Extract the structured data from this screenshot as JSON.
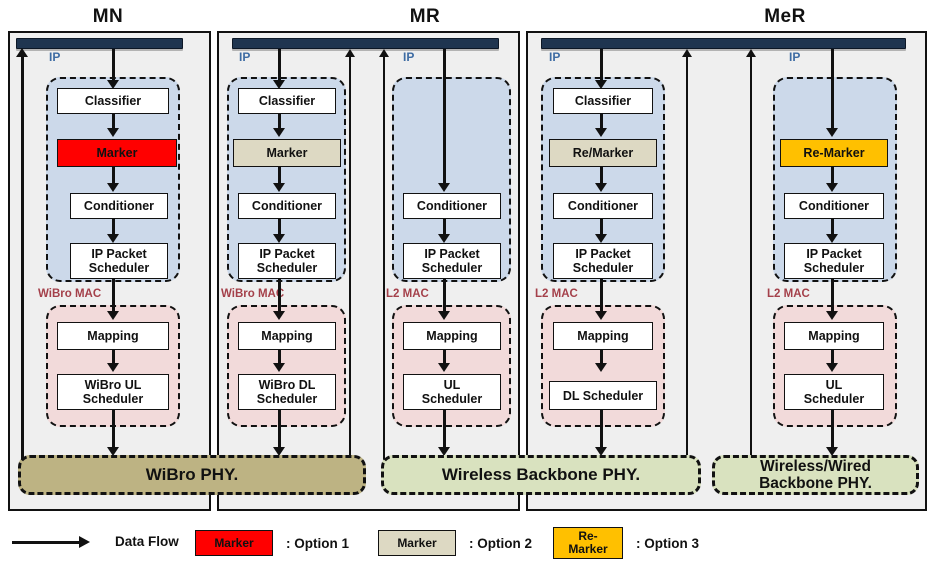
{
  "diagram": {
    "title_row": [
      {
        "label": "MN"
      },
      {
        "label": "MR"
      },
      {
        "label": "MeR"
      }
    ],
    "ip_label": "IP",
    "mac_labels": {
      "wibro": "WiBro MAC",
      "l2": "L2  MAC"
    },
    "columns": [
      {
        "id": "mn",
        "group": "MN",
        "mac_label": "WiBro MAC",
        "ip_blocks": [
          {
            "label": "Classifier",
            "style": "white"
          },
          {
            "label": "Marker",
            "style": "red"
          },
          {
            "label": "Conditioner",
            "style": "white"
          },
          {
            "label": "IP Packet\nScheduler",
            "style": "white"
          }
        ],
        "mac_blocks": [
          {
            "label": "Mapping",
            "style": "white"
          },
          {
            "label": "WiBro UL\nScheduler",
            "style": "white"
          }
        ]
      },
      {
        "id": "mr-access",
        "group": "MR",
        "mac_label": "WiBro MAC",
        "ip_blocks": [
          {
            "label": "Classifier",
            "style": "white"
          },
          {
            "label": "Marker",
            "style": "tan"
          },
          {
            "label": "Conditioner",
            "style": "white"
          },
          {
            "label": "IP Packet\nScheduler",
            "style": "white"
          }
        ],
        "mac_blocks": [
          {
            "label": "Mapping",
            "style": "white"
          },
          {
            "label": "WiBro DL\nScheduler",
            "style": "white"
          }
        ]
      },
      {
        "id": "mr-backbone",
        "group": "MR",
        "mac_label": "L2  MAC",
        "ip_blocks": [
          {
            "label": "Conditioner",
            "style": "white"
          },
          {
            "label": "IP Packet\nScheduler",
            "style": "white"
          }
        ],
        "mac_blocks": [
          {
            "label": "Mapping",
            "style": "white"
          },
          {
            "label": "UL\nScheduler",
            "style": "white"
          }
        ]
      },
      {
        "id": "mer-access",
        "group": "MeR",
        "mac_label": "L2 MAC",
        "ip_blocks": [
          {
            "label": "Classifier",
            "style": "white"
          },
          {
            "label": "Re/Marker",
            "style": "tan"
          },
          {
            "label": "Conditioner",
            "style": "white"
          },
          {
            "label": "IP Packet\nScheduler",
            "style": "white"
          }
        ],
        "mac_blocks": [
          {
            "label": "Mapping",
            "style": "white"
          },
          {
            "label": "DL Scheduler",
            "style": "white"
          }
        ]
      },
      {
        "id": "mer-backbone",
        "group": "MeR",
        "mac_label": "L2  MAC",
        "ip_blocks": [
          {
            "label": "Re-Marker",
            "style": "amber"
          },
          {
            "label": "Conditioner",
            "style": "white"
          },
          {
            "label": "IP Packet\nScheduler",
            "style": "white"
          }
        ],
        "mac_blocks": [
          {
            "label": "Mapping",
            "style": "white"
          },
          {
            "label": "UL\nScheduler",
            "style": "white"
          }
        ]
      }
    ],
    "phy_bars": [
      {
        "label": "WiBro PHY.",
        "style": "wibro"
      },
      {
        "label": "Wireless Backbone PHY.",
        "style": "green"
      },
      {
        "label": "Wireless/Wired\nBackbone PHY.",
        "style": "green"
      }
    ],
    "legend": {
      "data_flow_label": "Data Flow",
      "items": [
        {
          "swatch": "Marker",
          "style": "red",
          "caption": ": Option 1"
        },
        {
          "swatch": "Marker",
          "style": "tan",
          "caption": ": Option 2"
        },
        {
          "swatch": "Re-\nMarker",
          "style": "amber",
          "caption": ": Option 3"
        }
      ]
    },
    "colors": {
      "option1_red": "#ff0000",
      "option2_tan": "#ddd9c3",
      "option3_amber": "#ffc000",
      "ip_layer": "#ccd9ea",
      "mac_layer": "#f2dada",
      "wibro_phy": "#bdb383",
      "backbone_phy": "#d9e2bf",
      "ip_bar": "#1f3550",
      "panel_bg": "#efefef",
      "mac_label_text": "#a4404a",
      "ip_label_text": "#3d6ba3"
    }
  }
}
